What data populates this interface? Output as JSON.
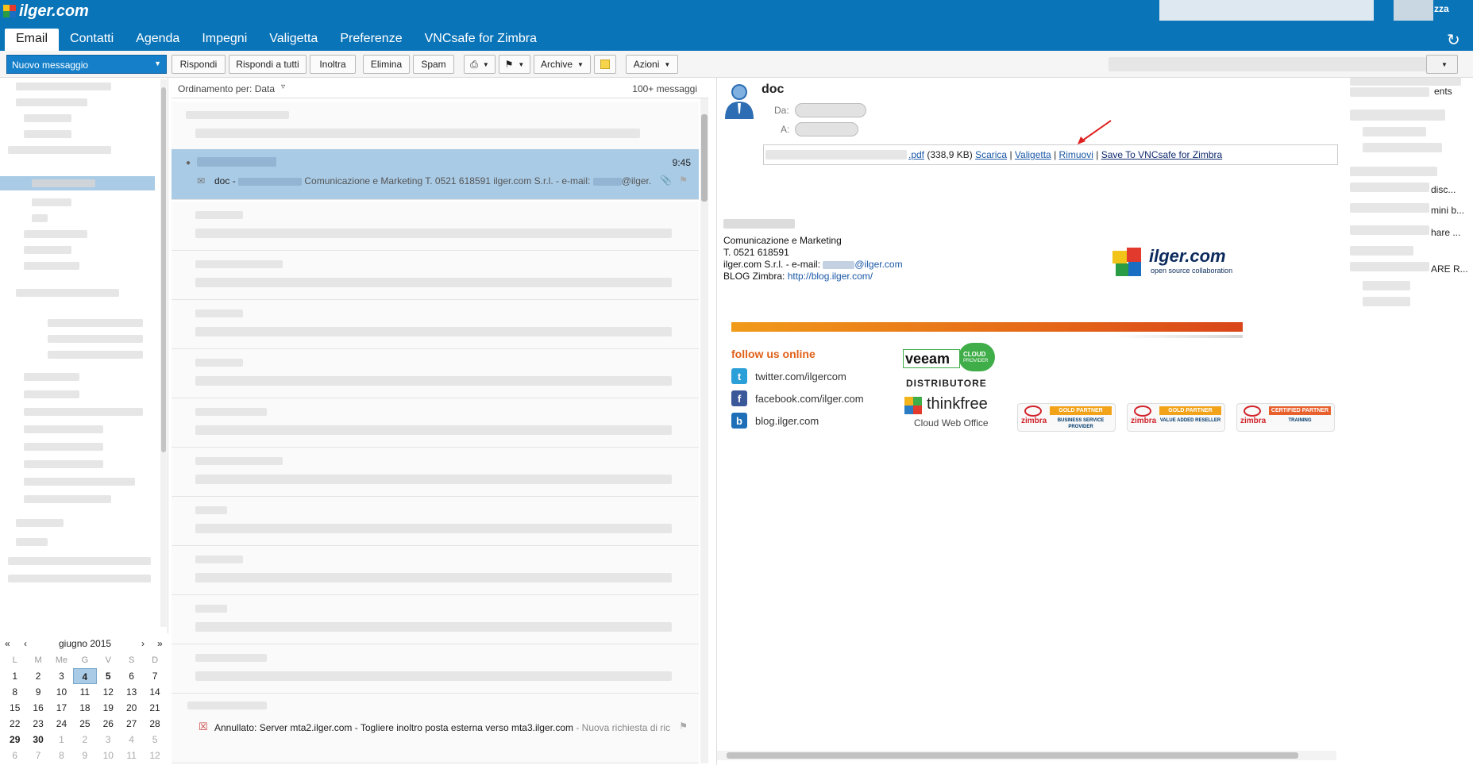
{
  "app": {
    "brand": "ilger.com",
    "user_suffix": "zza"
  },
  "tabs": [
    {
      "label": "Email"
    },
    {
      "label": "Contatti"
    },
    {
      "label": "Agenda"
    },
    {
      "label": "Impegni"
    },
    {
      "label": "Valigetta"
    },
    {
      "label": "Preferenze"
    },
    {
      "label": "VNCsafe for Zimbra"
    }
  ],
  "toolbar": {
    "new_message": "Nuovo messaggio",
    "reply": "Rispondi",
    "reply_all": "Rispondi a tutti",
    "forward": "Inoltra",
    "delete": "Elimina",
    "spam": "Spam",
    "archive": "Archive",
    "actions": "Azioni"
  },
  "list": {
    "sort_label": "Ordinamento per: Data",
    "count": "100+ messaggi",
    "selected": {
      "time": "9:45",
      "subject": "doc",
      "sep": " - ",
      "snippet": "Comunicazione e Marketing T. 0521 618591 ilger.com S.r.l. - e-mail:",
      "snippet_tail": "@ilger."
    },
    "last": {
      "subject": "Annullato: Server mta2.ilger.com - Togliere inoltro posta esterna verso mta3.ilger.com",
      "snippet": " - Nuova richiesta di ric"
    }
  },
  "calendar": {
    "month": "giugno 2015",
    "dow": [
      "L",
      "M",
      "Me",
      "G",
      "V",
      "S",
      "D"
    ],
    "weeks": [
      [
        "1",
        "2",
        "3",
        "4",
        "5",
        "6",
        "7"
      ],
      [
        "8",
        "9",
        "10",
        "11",
        "12",
        "13",
        "14"
      ],
      [
        "15",
        "16",
        "17",
        "18",
        "19",
        "20",
        "21"
      ],
      [
        "22",
        "23",
        "24",
        "25",
        "26",
        "27",
        "28"
      ],
      [
        "29",
        "30",
        "1",
        "2",
        "3",
        "4",
        "5"
      ],
      [
        "6",
        "7",
        "8",
        "9",
        "10",
        "11",
        "12"
      ]
    ],
    "today": "4"
  },
  "reader": {
    "subject": "doc",
    "from_label": "Da:",
    "to_label": "A:",
    "attachment": {
      "name_suffix": ".pdf",
      "size": "(338,9 KB)",
      "download": "Scarica",
      "briefcase": "Valigetta",
      "remove": "Rimuovi",
      "vnc": "Save To VNCsafe for Zimbra",
      "sep": "|"
    },
    "signature": {
      "line1": "Comunicazione e Marketing",
      "line2": "T. 0521 618591",
      "line3_prefix": "ilger.com S.r.l. - e-mail: ",
      "line3_email": "@ilger.com",
      "line4_prefix": "BLOG Zimbra: ",
      "line4_link": "http://blog.ilger.com/"
    },
    "banner": {
      "brand": "ilger.com",
      "tagline": "open source collaboration"
    },
    "follow_title": "follow us online",
    "social": [
      {
        "name": "twitter.com/ilgercom",
        "icon": "twitter-icon",
        "color": "#2b9fd8"
      },
      {
        "name": "facebook.com/ilger.com",
        "icon": "facebook-icon",
        "color": "#3b5998"
      },
      {
        "name": "blog.ilger.com",
        "icon": "blogger-icon",
        "color": "#1e6fb8"
      }
    ],
    "veeam": {
      "name": "veeam",
      "tag1": "CLOUD",
      "tag2": "PROVIDER"
    },
    "distributore": "DISTRIBUTORE",
    "thinkfree": {
      "name": "thinkfree",
      "sub": "Cloud Web Office"
    },
    "badges": [
      {
        "top": "GOLD PARTNER",
        "sub": "BUSINESS SERVICE PROVIDER",
        "color": "#f2a31a"
      },
      {
        "top": "GOLD PARTNER",
        "sub": "VALUE ADDED RESELLER",
        "color": "#f2a31a"
      },
      {
        "top": "CERTIFIED PARTNER",
        "sub": "TRAINING",
        "color": "#e8612c"
      }
    ],
    "badge_brand": "zimbra"
  },
  "right": {
    "items": [
      "ents",
      "disc...",
      "mini b...",
      "hare ...",
      "ARE R..."
    ]
  },
  "colors": {
    "topbar": "#0a74b8",
    "selected_row": "#a9cbe6",
    "link": "#1a58a6",
    "accent_orange": "#e0611a"
  }
}
